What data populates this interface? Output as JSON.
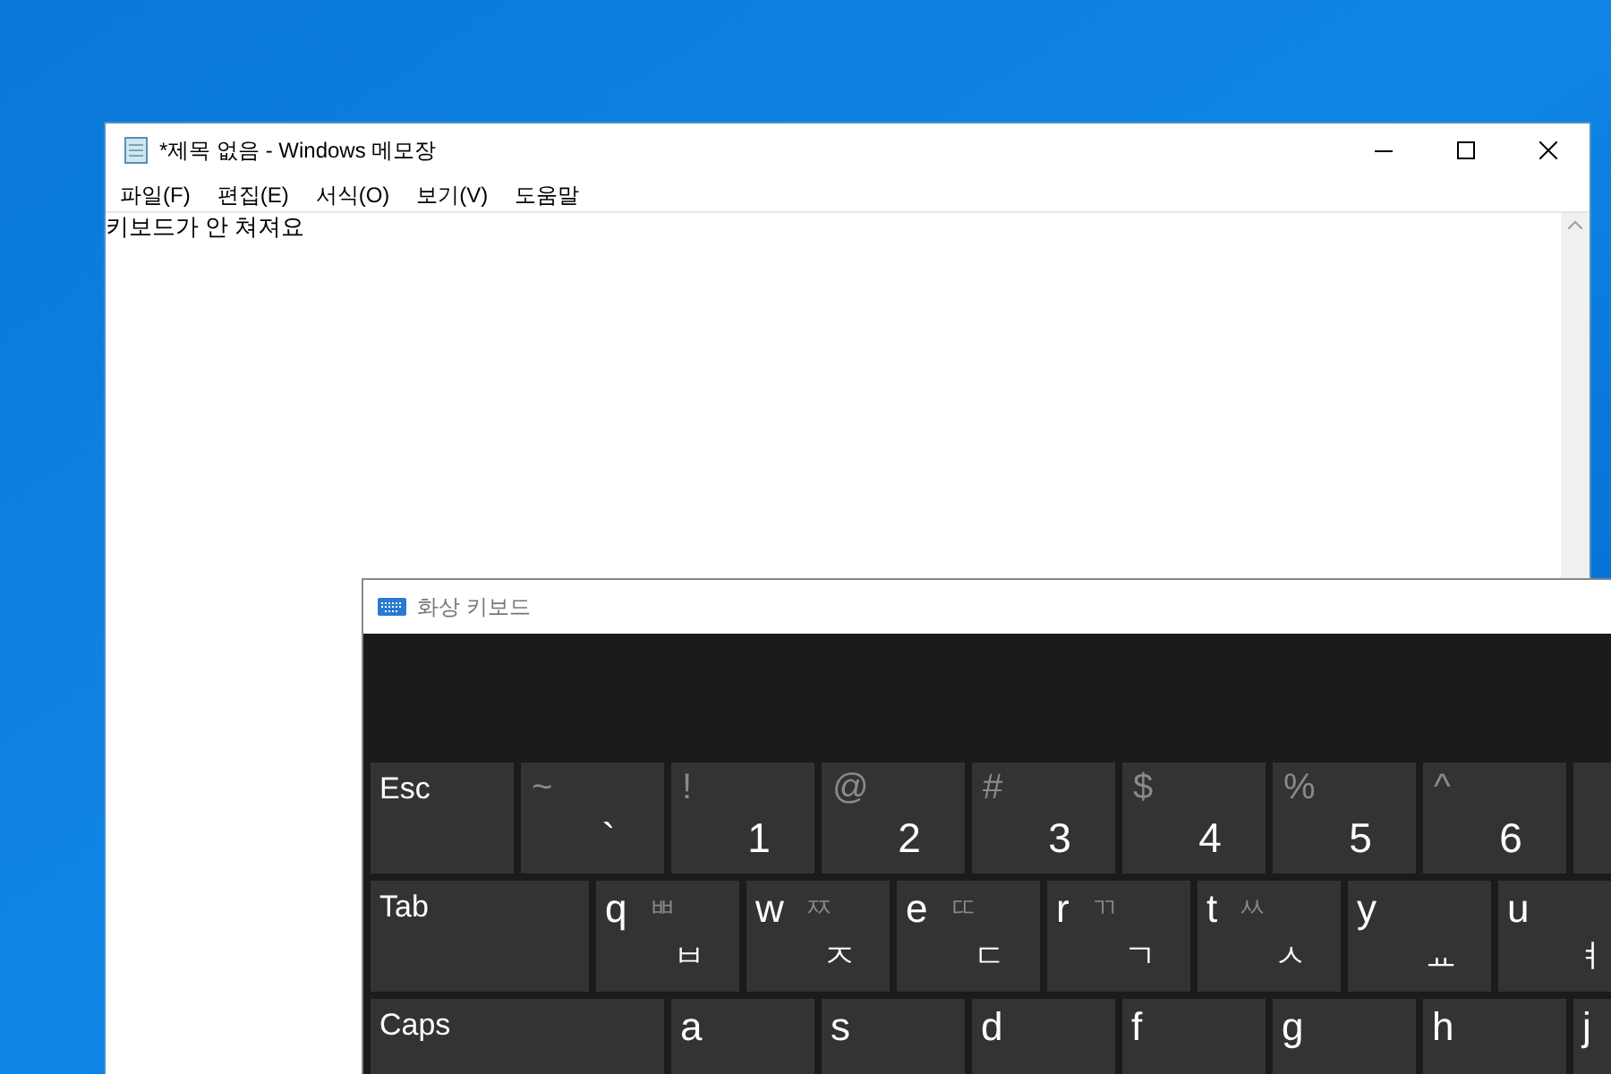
{
  "notepad": {
    "title": "*제목 없음 - Windows 메모장",
    "menu": [
      "파일(F)",
      "편집(E)",
      "서식(O)",
      "보기(V)",
      "도움말"
    ],
    "text": "키보드가 안 쳐져요"
  },
  "osk": {
    "title": "화상 키보드",
    "rows": [
      [
        {
          "kind": "special",
          "label": "Esc"
        },
        {
          "kind": "number",
          "shift": "~",
          "main": "`"
        },
        {
          "kind": "number",
          "shift": "!",
          "main": "1"
        },
        {
          "kind": "number",
          "shift": "@",
          "main": "2"
        },
        {
          "kind": "number",
          "shift": "#",
          "main": "3"
        },
        {
          "kind": "number",
          "shift": "$",
          "main": "4"
        },
        {
          "kind": "number",
          "shift": "%",
          "main": "5"
        },
        {
          "kind": "number",
          "shift": "^",
          "main": "6"
        },
        {
          "kind": "number"
        }
      ],
      [
        {
          "kind": "wide",
          "label": "Tab"
        },
        {
          "kind": "letter",
          "main": "q",
          "shift": "ㅃ",
          "hangul": "ㅂ"
        },
        {
          "kind": "letter",
          "main": "w",
          "shift": "ㅉ",
          "hangul": "ㅈ"
        },
        {
          "kind": "letter",
          "main": "e",
          "shift": "ㄸ",
          "hangul": "ㄷ"
        },
        {
          "kind": "letter",
          "main": "r",
          "shift": "ㄲ",
          "hangul": "ㄱ"
        },
        {
          "kind": "letter",
          "main": "t",
          "shift": "ㅆ",
          "hangul": "ㅅ"
        },
        {
          "kind": "letter",
          "main": "y",
          "hangul": "ㅛ"
        },
        {
          "kind": "letter",
          "main": "u",
          "hangul": "ㅕ"
        }
      ],
      [
        {
          "kind": "wider",
          "label": "Caps"
        },
        {
          "kind": "letter",
          "main": "a"
        },
        {
          "kind": "letter",
          "main": "s"
        },
        {
          "kind": "letter",
          "main": "d"
        },
        {
          "kind": "letter",
          "main": "f"
        },
        {
          "kind": "letter",
          "main": "g"
        },
        {
          "kind": "letter",
          "main": "h"
        },
        {
          "kind": "letter",
          "main": "j"
        }
      ]
    ]
  }
}
